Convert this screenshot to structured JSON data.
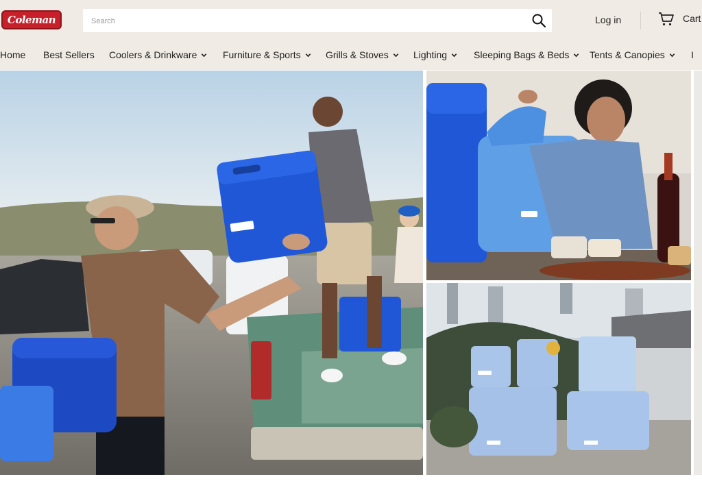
{
  "brand": {
    "logo_text": "Coleman",
    "color": "#c8202a"
  },
  "search": {
    "placeholder": "Search",
    "value": "",
    "icon": "search-icon"
  },
  "header": {
    "login_label": "Log in",
    "cart_label": "Cart",
    "cart_icon": "cart-icon"
  },
  "nav": {
    "items": [
      {
        "label": "Home"
      },
      {
        "label": "Best Sellers"
      },
      {
        "label": "Coolers & Drinkware"
      },
      {
        "label": "Furniture & Sports"
      },
      {
        "label": "Grills & Stoves"
      },
      {
        "label": "Lighting"
      },
      {
        "label": "Sleeping Bags & Beds"
      },
      {
        "label": "Tents & Canopies"
      }
    ]
  },
  "hero": {
    "main_image": "friends-tossing-blue-cooler-truck-photo",
    "side_top_image": "man-with-blue-soft-cooler-photo",
    "side_bottom_image": "light-blue-coolers-rooftop-photo"
  },
  "colors": {
    "topbar": "#f0ebe4",
    "cooler_blue": "#1f57d6",
    "light_blue": "#a9c5ea"
  }
}
